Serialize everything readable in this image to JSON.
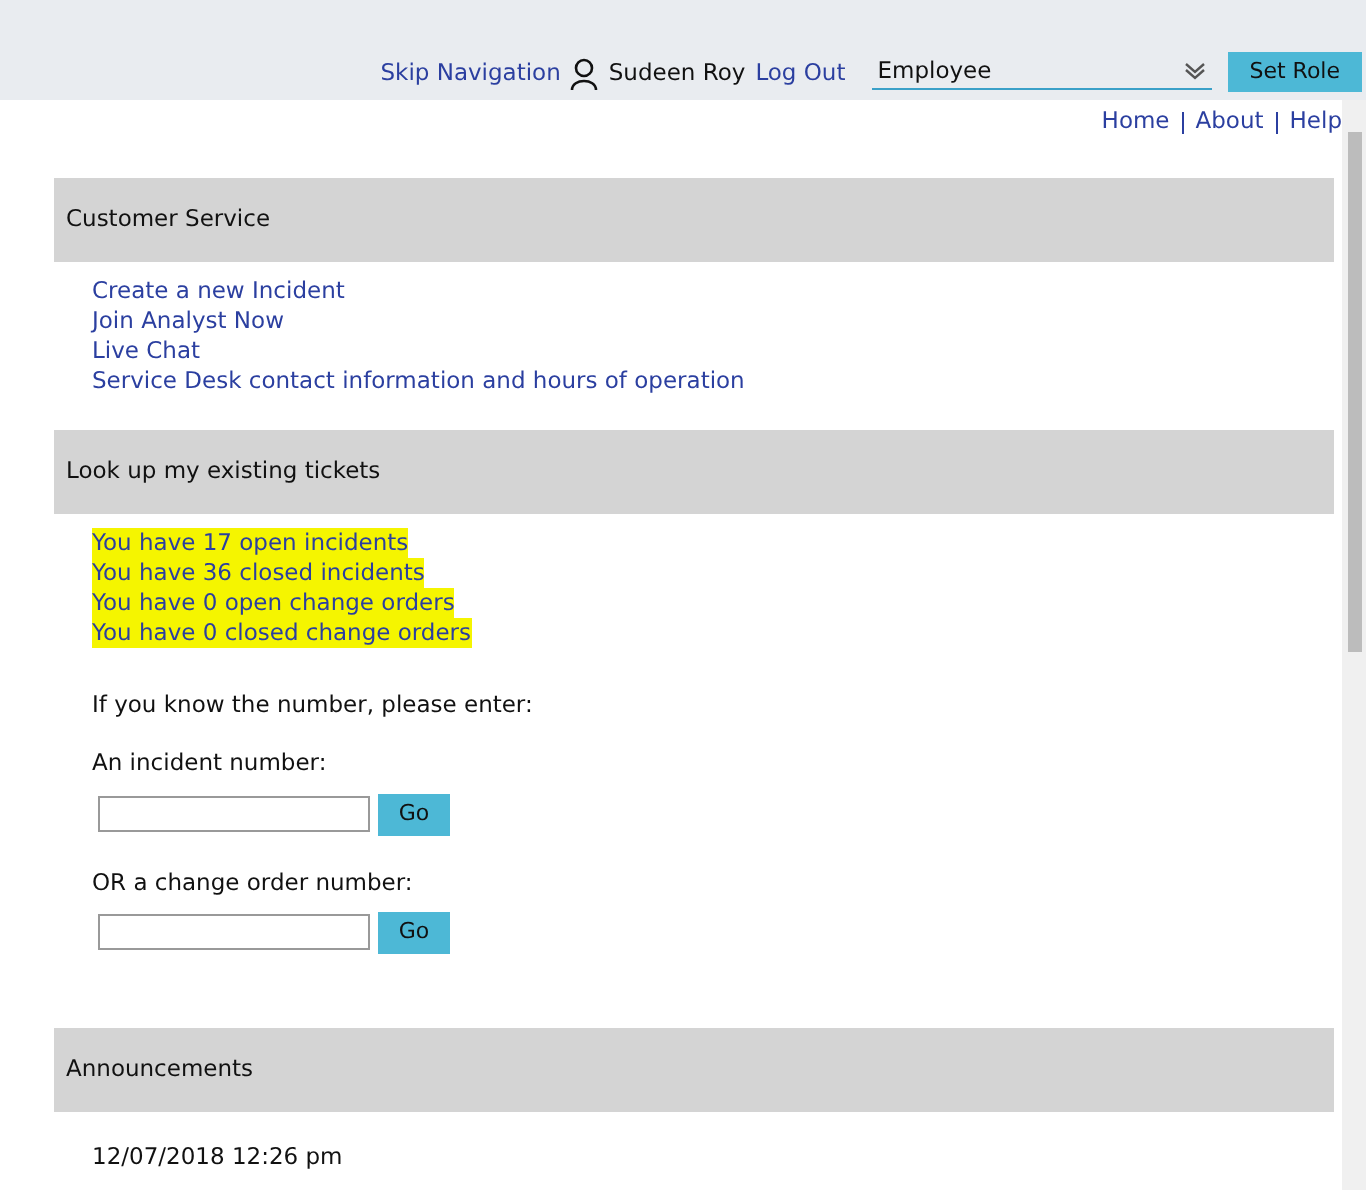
{
  "header": {
    "skip_link": "Skip Navigation",
    "user_name": "Sudeen Roy",
    "logout": "Log Out",
    "role_select": {
      "value": "Employee"
    },
    "set_role_button": "Set Role"
  },
  "top_nav": [
    "Home",
    "About",
    "Help"
  ],
  "sections": [
    {
      "title": "Customer Service",
      "links": [
        {
          "label": "Create a new Incident",
          "highlighted": false
        },
        {
          "label": "Join Analyst Now",
          "highlighted": false
        },
        {
          "label": "Live Chat",
          "highlighted": false
        },
        {
          "label": "Service Desk contact information and hours of operation",
          "highlighted": false
        }
      ]
    },
    {
      "title": "Look up my existing tickets",
      "links": [
        {
          "label": "You have 17 open incidents",
          "highlighted": true
        },
        {
          "label": "You have 36 closed incidents",
          "highlighted": true
        },
        {
          "label": "You have 0 open change orders",
          "highlighted": true
        },
        {
          "label": "You have 0 closed change orders",
          "highlighted": true
        }
      ],
      "lookup": {
        "prompt": "If you know the number, please enter:",
        "fields": [
          {
            "label": "An incident number:",
            "button": "Go"
          },
          {
            "label": "OR a change order number:",
            "button": "Go"
          }
        ]
      }
    },
    {
      "title": "Announcements",
      "items": [
        "12/07/2018 12:26 pm"
      ]
    }
  ]
}
